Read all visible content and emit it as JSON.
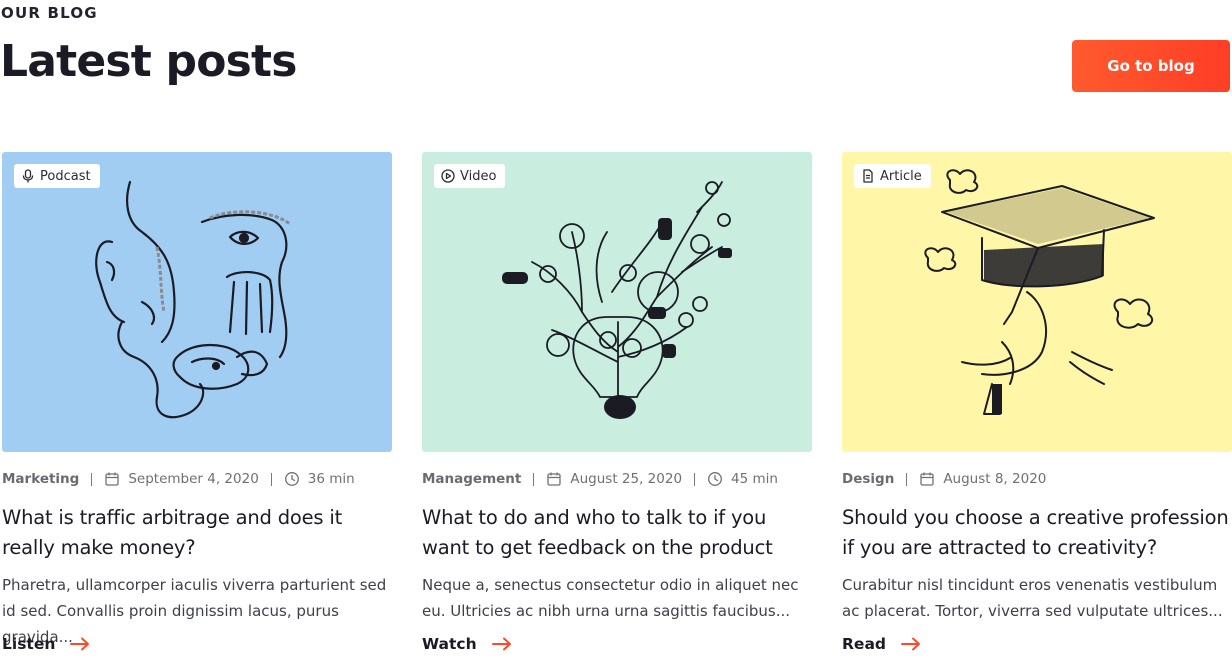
{
  "header": {
    "eyebrow": "OUR BLOG",
    "title": "Latest posts",
    "cta_label": "Go to blog"
  },
  "colors": {
    "accent": "#ff4a2a",
    "card_blue": "#a2cdf3",
    "card_mint": "#c9eee0",
    "card_yellow": "#fff6a8",
    "text_dark": "#1b1b26",
    "text_muted": "#6f6f78"
  },
  "posts": [
    {
      "tag": "Podcast",
      "tag_icon": "microphone-icon",
      "category": "Marketing",
      "date": "September 4, 2020",
      "duration": "36 min",
      "title": "What is traffic arbitrage and does it really make money?",
      "excerpt": "Pharetra, ullamcorper iaculis viverra parturient sed id sed. Convallis proin dignissim lacus, purus gravida...",
      "action": "Listen"
    },
    {
      "tag": "Video",
      "tag_icon": "play-icon",
      "category": "Management",
      "date": "August 25, 2020",
      "duration": "45 min",
      "title": "What to do and who to talk to if you want to get feedback on the product",
      "excerpt": "Neque a, senectus consectetur odio in aliquet nec eu. Ultricies ac nibh urna urna sagittis faucibus...",
      "action": "Watch"
    },
    {
      "tag": "Article",
      "tag_icon": "document-icon",
      "category": "Design",
      "date": "August 8, 2020",
      "title": "Should you choose a creative profession if you are attracted to creativity?",
      "excerpt": "Curabitur nisl tincidunt eros venenatis vestibulum ac placerat. Tortor, viverra sed vulputate ultrices...",
      "action": "Read"
    }
  ]
}
